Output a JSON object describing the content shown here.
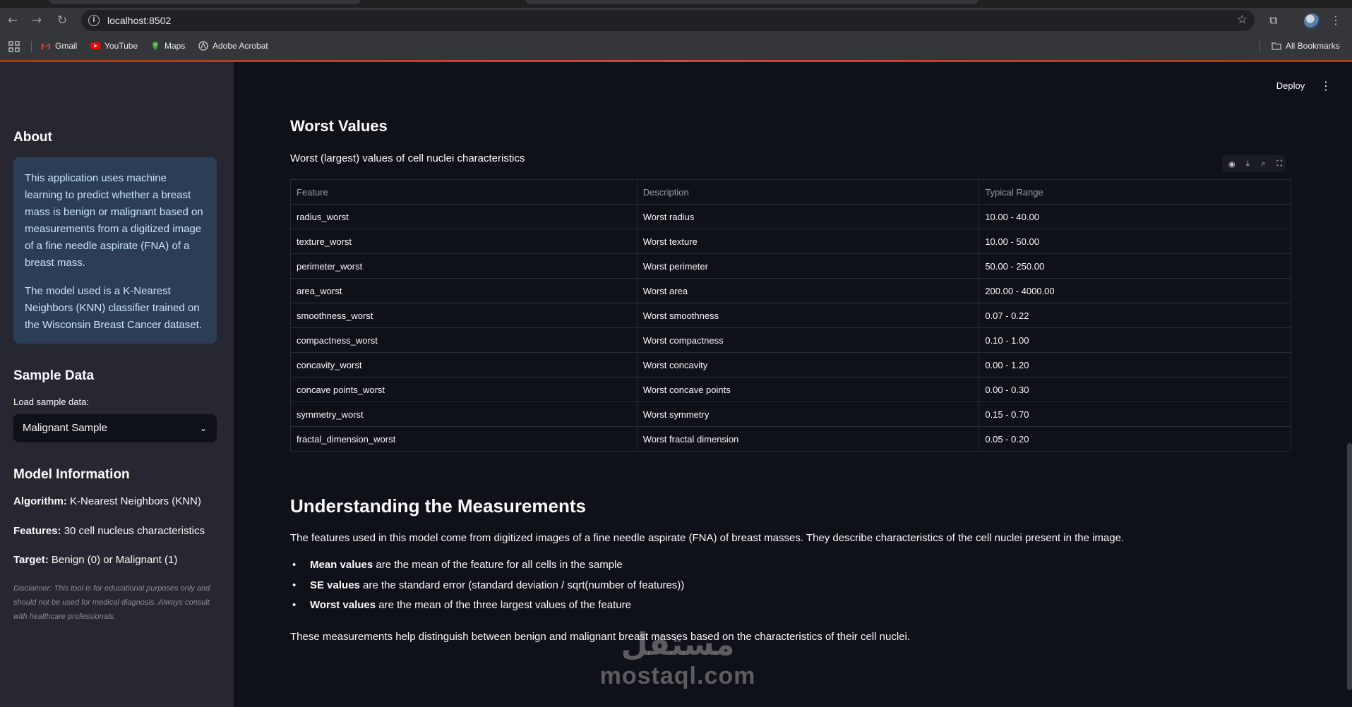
{
  "browser": {
    "url": "localhost:8502",
    "bookmarks": [
      {
        "label": "Gmail",
        "icon": "gmail-icon"
      },
      {
        "label": "YouTube",
        "icon": "youtube-icon"
      },
      {
        "label": "Maps",
        "icon": "maps-icon"
      },
      {
        "label": "Adobe Acrobat",
        "icon": "acrobat-icon"
      }
    ],
    "all_bookmarks": "All Bookmarks"
  },
  "sidebar": {
    "about_title": "About",
    "about_p1": "This application uses machine learning to predict whether a breast mass is benign or malignant based on measurements from a digitized image of a fine needle aspirate (FNA) of a breast mass.",
    "about_p2": "The model used is a K-Nearest Neighbors (KNN) classifier trained on the Wisconsin Breast Cancer dataset.",
    "sample_title": "Sample Data",
    "sample_label": "Load sample data:",
    "sample_selected": "Malignant Sample",
    "model_title": "Model Information",
    "algorithm_label": "Algorithm:",
    "algorithm_value": " K-Nearest Neighbors (KNN)",
    "features_label": "Features:",
    "features_value": " 30 cell nucleus characteristics",
    "target_label": "Target:",
    "target_value": " Benign (0) or Malignant (1)",
    "disclaimer": "Disclaimer: This tool is for educational purposes only and should not be used for medical diagnosis. Always consult with healthcare professionals."
  },
  "header": {
    "deploy": "Deploy",
    "menu_icon": "⋮"
  },
  "main": {
    "worst_title": "Worst Values",
    "worst_caption": "Worst (largest) values of cell nuclei characteristics",
    "table_columns": [
      "Feature",
      "Description",
      "Typical Range"
    ],
    "table_rows": [
      [
        "radius_worst",
        "Worst radius",
        "10.00 - 40.00"
      ],
      [
        "texture_worst",
        "Worst texture",
        "10.00 - 50.00"
      ],
      [
        "perimeter_worst",
        "Worst perimeter",
        "50.00 - 250.00"
      ],
      [
        "area_worst",
        "Worst area",
        "200.00 - 4000.00"
      ],
      [
        "smoothness_worst",
        "Worst smoothness",
        "0.07 - 0.22"
      ],
      [
        "compactness_worst",
        "Worst compactness",
        "0.10 - 1.00"
      ],
      [
        "concavity_worst",
        "Worst concavity",
        "0.00 - 1.20"
      ],
      [
        "concave points_worst",
        "Worst concave points",
        "0.00 - 0.30"
      ],
      [
        "symmetry_worst",
        "Worst symmetry",
        "0.15 - 0.70"
      ],
      [
        "fractal_dimension_worst",
        "Worst fractal dimension",
        "0.05 - 0.20"
      ]
    ],
    "understanding_title": "Understanding the Measurements",
    "understanding_intro": "The features used in this model come from digitized images of a fine needle aspirate (FNA) of breast masses. They describe characteristics of the cell nuclei present in the image.",
    "bullets": [
      {
        "bold": "Mean values",
        "text": " are the mean of the feature for all cells in the sample"
      },
      {
        "bold": "SE values",
        "text": " are the standard error (standard deviation / sqrt(number of features))"
      },
      {
        "bold": "Worst values",
        "text": " are the mean of the three largest values of the feature"
      }
    ],
    "conclusion": "These measurements help distinguish between benign and malignant breast masses based on the characteristics of their cell nuclei."
  },
  "watermark": {
    "arabic": "مستقل",
    "latin": "mostaql.com"
  },
  "colors": {
    "app_bg": "#0e1117",
    "sidebar_bg": "#262730",
    "info_box_bg": "#2c3e55",
    "info_box_text": "#c9e4ff",
    "accent": "#ff4b4b"
  }
}
